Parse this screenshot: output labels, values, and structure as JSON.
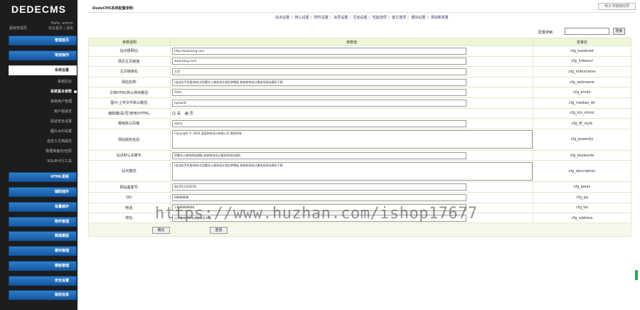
{
  "app": {
    "logo": "DEDECMS"
  },
  "user": {
    "greeting": "Hello, admin",
    "links": "前台首页 | 退出",
    "role": "超级管理员"
  },
  "colors": {
    "sidebar_bg": "#1d1d1d",
    "menu_blue": "#1f6bb7",
    "table_header": "#eef6da"
  },
  "sidebar": {
    "menus_top": [
      {
        "label": "管理首页"
      },
      {
        "label": "常用操作"
      },
      {
        "label": "系统设置"
      }
    ],
    "sub_items": [
      {
        "label": "系统后台"
      },
      {
        "label": "系统基本参数"
      },
      {
        "label": "系统用户管理"
      },
      {
        "label": "用户组设定"
      },
      {
        "label": "验证安全设置"
      },
      {
        "label": "图片水印设置"
      },
      {
        "label": "自定义文档属性"
      },
      {
        "label": "数据库备份/还原"
      },
      {
        "label": "SQL命令行工具"
      }
    ],
    "menus_bottom": [
      {
        "label": "HTML更新"
      },
      {
        "label": "辅助插件"
      },
      {
        "label": "批量维护"
      },
      {
        "label": "附件管理"
      },
      {
        "label": "频道模型"
      },
      {
        "label": "模块管理"
      },
      {
        "label": "模板管理"
      },
      {
        "label": "安全设置"
      },
      {
        "label": "版权信息"
      }
    ]
  },
  "header": {
    "title": "DedeCMS系统配置参数:",
    "top_button": "电子书使用向导"
  },
  "tabs": [
    "站点设置",
    "核心设置",
    "附件设置",
    "会员设置",
    "互动设置",
    "性能选项",
    "其它选项",
    "模块设置",
    "添加新变量"
  ],
  "search": {
    "label": "配置搜索:",
    "button": "搜索",
    "value": ""
  },
  "table": {
    "headers": {
      "desc": "参数说明",
      "value": "参数值",
      "var": "变量名"
    },
    "rows": [
      {
        "desc": "站点根网址:",
        "value": "http://www.kskg.com",
        "var": "cfg_basehost"
      },
      {
        "desc": "网页主页链接:",
        "value": "www.kskg.com/",
        "var": "cfg_indexurl"
      },
      {
        "desc": "主页链接名:",
        "value": "主页",
        "var": "cfg_indexname"
      },
      {
        "desc": "网站名称:",
        "value": "(自适应手机版)响应式别墅办公装饰设计类织梦模板 装修装饰设计事务所网站源码下载",
        "var": "cfg_webname"
      },
      {
        "desc": "文档HTML默认保存路径:",
        "value": "/html",
        "var": "cfg_arcdir"
      },
      {
        "desc": "图片/上传文件默认路径:",
        "value": "/uploads",
        "var": "cfg_medias_dir"
      },
      {
        "desc": "编辑器(是/否)使用XHTML:",
        "radio": {
          "yes": "是",
          "no": "否"
        },
        "var": "cfg_fck_xhtml"
      },
      {
        "desc": "模板默认风格:",
        "value": "dama",
        "var": "cfg_df_style"
      },
      {
        "desc": "网站版权信息:",
        "value": "Copyright © 2020 某某装修设计有限公司 版权所有",
        "var": "cfg_powerby",
        "textarea": true
      },
      {
        "desc": "站点默认关键字:",
        "value": "别墅办公装饰网站模板,装修装饰设计事务所网站源码",
        "var": "cfg_keywords"
      },
      {
        "desc": "站点描述:",
        "value": "(自适应手机版)响应式别墅办公装饰设计类织梦模板 装修装饰设计事务所网站源码下载",
        "var": "cfg_description",
        "textarea": true
      },
      {
        "desc": "网站备案号:",
        "value": "苏ICP12345678",
        "var": "cfg_beian"
      },
      {
        "desc": "QQ:",
        "value": "88888888",
        "var": "cfg_qq"
      },
      {
        "desc": "电话:",
        "value": "13888888888",
        "var": "cfg_tel"
      },
      {
        "desc": "地址:",
        "value": "江苏省南京市玄武区玄武大道",
        "var": "cfg_address"
      }
    ]
  },
  "actions": {
    "submit": "确定",
    "reset": "重置"
  },
  "watermark": "https://www.huzhan.com/ishop17677"
}
